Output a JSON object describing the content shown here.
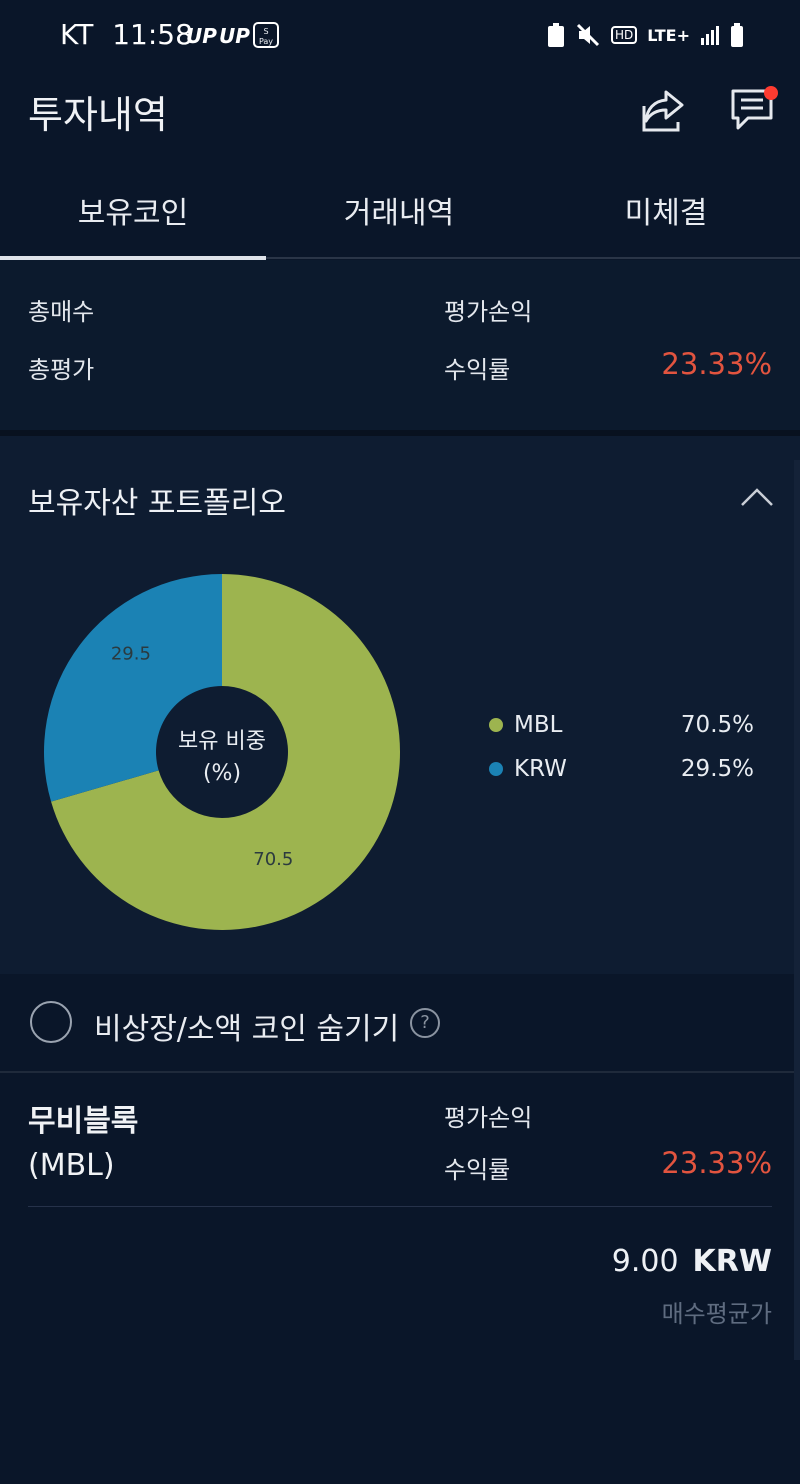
{
  "status_bar": {
    "carrier": "KT",
    "time": "11:58",
    "badges": [
      "UP",
      "UP"
    ],
    "pay_label": "Samsung Pay",
    "network": "LTE+",
    "hd": "HD"
  },
  "header": {
    "title": "투자내역",
    "share_icon": "share-icon",
    "message_icon": "message-icon"
  },
  "tabs": [
    {
      "label": "보유코인",
      "active": true
    },
    {
      "label": "거래내역",
      "active": false
    },
    {
      "label": "미체결",
      "active": false
    }
  ],
  "summary": {
    "total_buy_label": "총매수",
    "total_eval_label": "총평가",
    "pnl_label": "평가손익",
    "return_label": "수익률",
    "return_value": "23.33%"
  },
  "portfolio": {
    "title": "보유자산 포트폴리오",
    "center_label_1": "보유 비중",
    "center_label_2": "(%)",
    "legend": [
      {
        "name": "MBL",
        "value": "70.5%",
        "color": "#9db44f"
      },
      {
        "name": "KRW",
        "value": "29.5%",
        "color": "#1b82b4"
      }
    ]
  },
  "chart_data": {
    "type": "pie",
    "categories": [
      "MBL",
      "KRW"
    ],
    "values": [
      70.5,
      29.5
    ],
    "labels": [
      "70.5",
      "29.5"
    ],
    "colors": [
      "#9db44f",
      "#1b82b4"
    ],
    "title": "",
    "legend": "right"
  },
  "hide_option": {
    "label": "비상장/소액 코인 숨기기",
    "help": "?"
  },
  "holding": {
    "name": "무비블록",
    "symbol": "(MBL)",
    "pnl_label": "평가손익",
    "return_label": "수익률",
    "return_value": "23.33%",
    "avg_price": "9.00",
    "currency": "KRW",
    "avg_price_label": "매수평균가"
  }
}
